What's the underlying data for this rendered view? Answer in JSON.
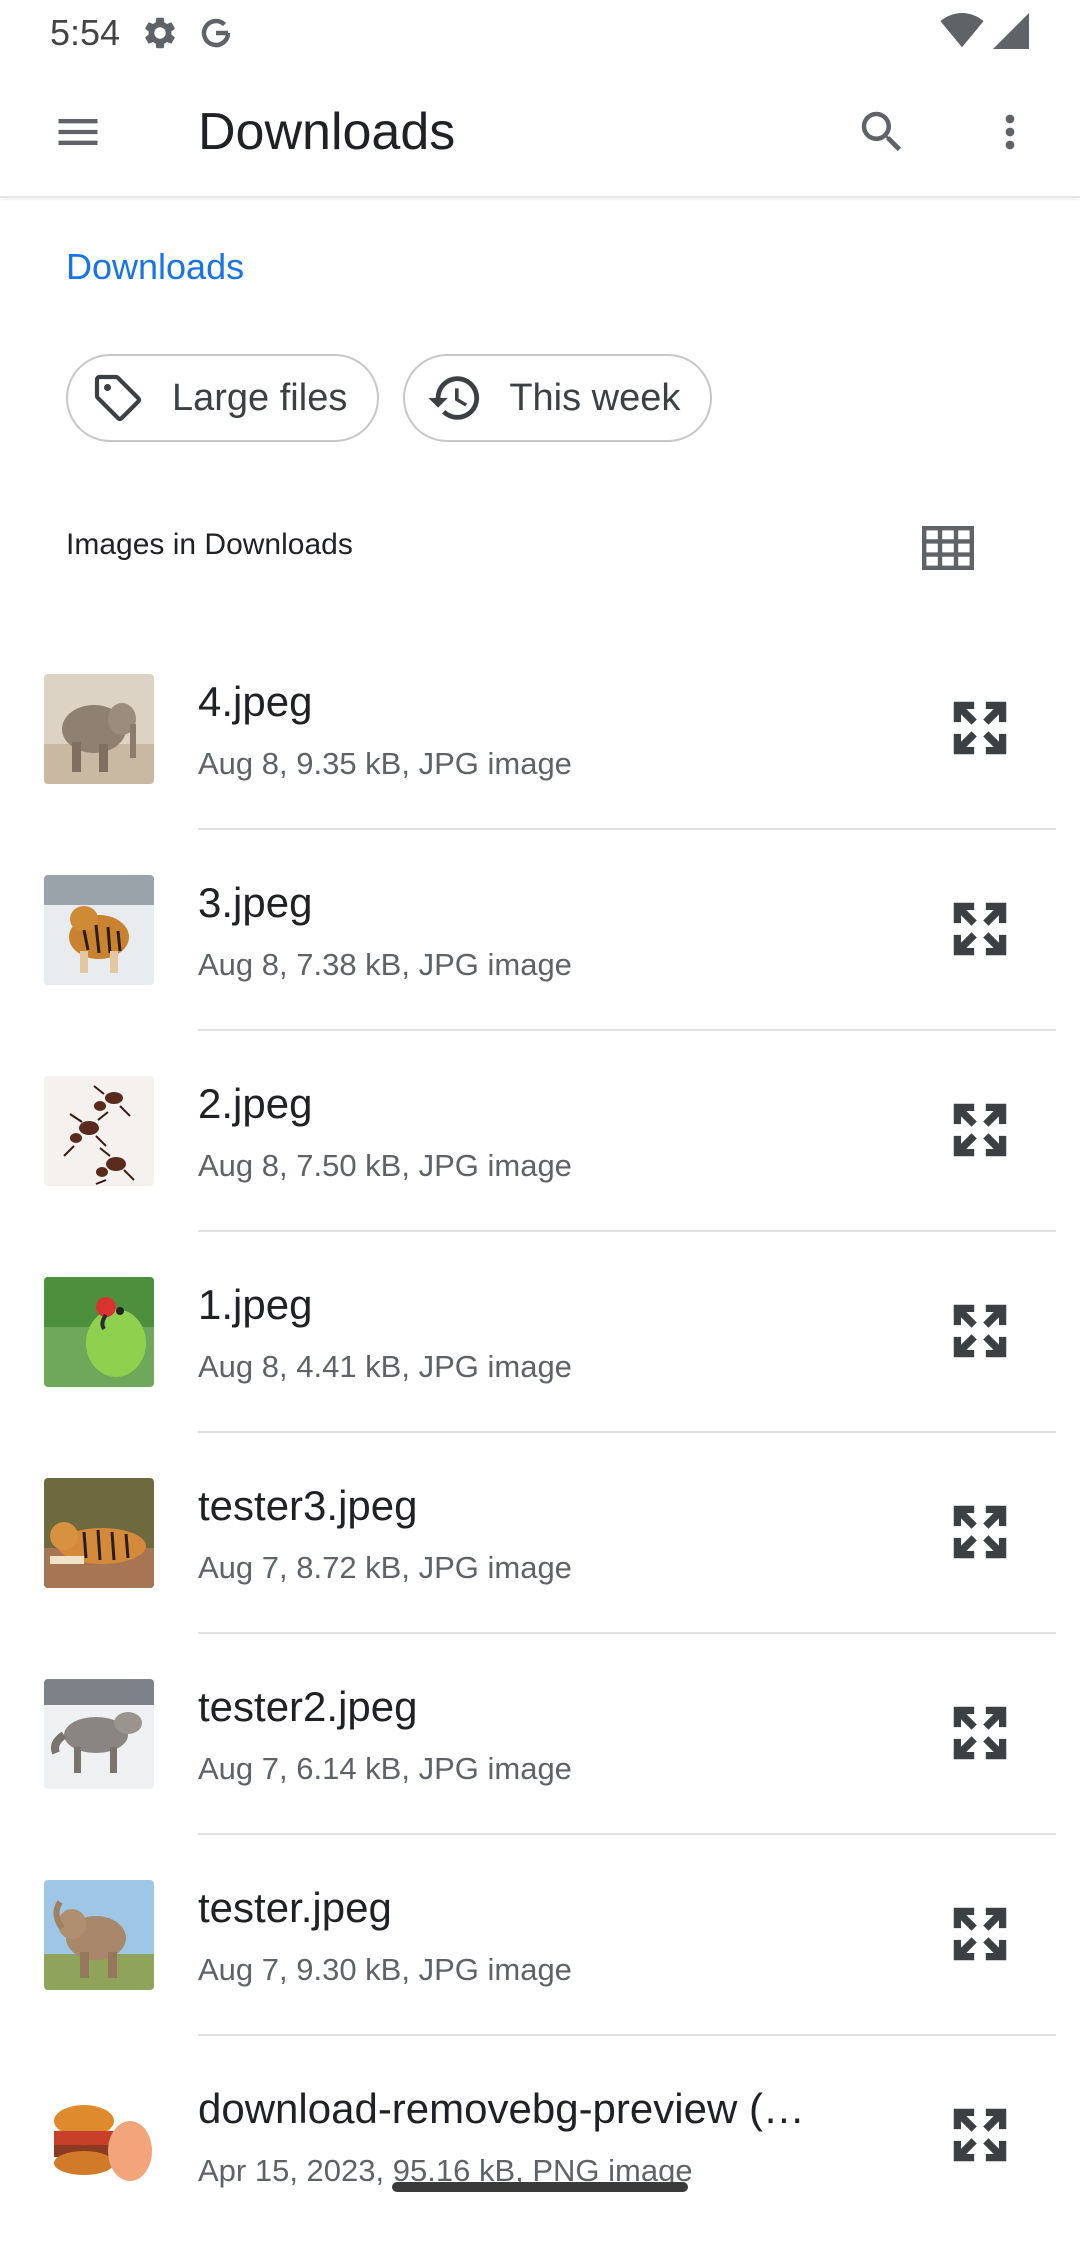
{
  "status_bar": {
    "time": "5:54",
    "icons": [
      "settings-gear-icon",
      "google-g-icon",
      "wifi-icon",
      "cell-signal-icon"
    ]
  },
  "app_bar": {
    "title": "Downloads",
    "icons": [
      "menu-icon",
      "search-icon",
      "more-vert-icon"
    ]
  },
  "breadcrumb": {
    "label": "Downloads"
  },
  "chips": [
    {
      "label": "Large files",
      "icon": "label-tag-icon"
    },
    {
      "label": "This week",
      "icon": "history-icon"
    }
  ],
  "section": {
    "title": "Images in Downloads",
    "view_toggle_icon": "grid-view-icon"
  },
  "files": [
    {
      "name": "4.jpeg",
      "meta": "Aug 8, 9.35 kB, JPG image",
      "thumb": "elephant"
    },
    {
      "name": "3.jpeg",
      "meta": "Aug 8, 7.38 kB, JPG image",
      "thumb": "tiger-snow"
    },
    {
      "name": "2.jpeg",
      "meta": "Aug 8, 7.50 kB, JPG image",
      "thumb": "ants"
    },
    {
      "name": "1.jpeg",
      "meta": "Aug 8, 4.41 kB, JPG image",
      "thumb": "parrot"
    },
    {
      "name": "tester3.jpeg",
      "meta": "Aug 7, 8.72 kB, JPG image",
      "thumb": "tiger-lying"
    },
    {
      "name": "tester2.jpeg",
      "meta": "Aug 7, 6.14 kB, JPG image",
      "thumb": "wolf"
    },
    {
      "name": "tester.jpeg",
      "meta": "Aug 7, 9.30 kB, JPG image",
      "thumb": "elephant-field"
    },
    {
      "name": "download-removebg-preview (…",
      "meta": "Apr 15, 2023, 95.16 kB, PNG image",
      "thumb": "food"
    }
  ],
  "colors": {
    "accent": "#1a73e8",
    "text_primary": "#202124",
    "text_secondary": "#5f6368",
    "divider": "#e0e0e0"
  }
}
